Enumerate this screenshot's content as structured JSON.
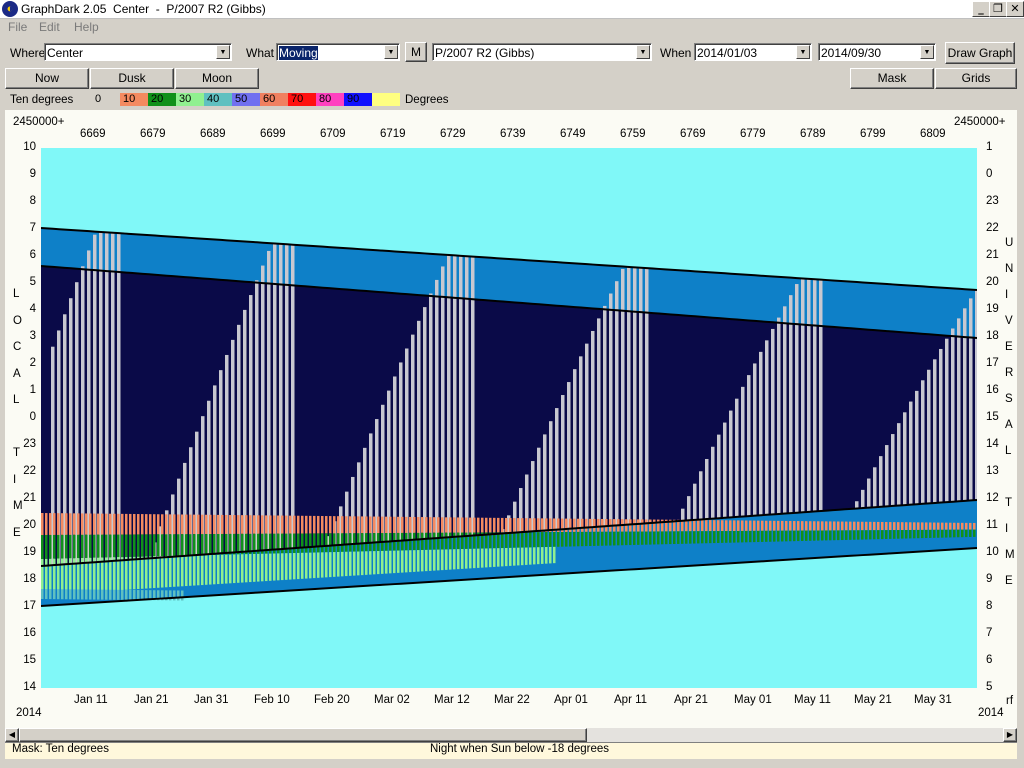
{
  "window": {
    "title": "GraphDark 2.05  Center  -  P/2007 R2 (Gibbs)",
    "minimize": "_",
    "restore": "❐",
    "close": "✕"
  },
  "menu": [
    "File",
    "Edit",
    "Help"
  ],
  "toolbar": {
    "where_label": "Where",
    "where_value": "Center",
    "what_label": "What",
    "what_value": "Moving",
    "m_button": "M",
    "object_value": "P/2007 R2 (Gibbs)",
    "when_label": "When",
    "start_date": "2014/01/03",
    "end_date": "2014/09/30",
    "draw_graph": "Draw Graph"
  },
  "buttons": {
    "now": "Now",
    "dusk": "Dusk",
    "moon": "Moon",
    "mask": "Mask",
    "grids": "Grids"
  },
  "legend": {
    "title": "Ten degrees",
    "unit": "Degrees",
    "entries": [
      {
        "label": "0",
        "color": "#d4d0c8"
      },
      {
        "label": "10",
        "color": "#f48a60"
      },
      {
        "label": "20",
        "color": "#10901a"
      },
      {
        "label": "30",
        "color": "#90f090"
      },
      {
        "label": "40",
        "color": "#5fc0c0"
      },
      {
        "label": "50",
        "color": "#7070f0"
      },
      {
        "label": "60",
        "color": "#f08060"
      },
      {
        "label": "70",
        "color": "#ff1010"
      },
      {
        "label": "80",
        "color": "#ff40c0"
      },
      {
        "label": "90",
        "color": "#1010ff"
      },
      {
        "label": "",
        "color": "#ffff80"
      }
    ]
  },
  "graph": {
    "jd_prefix_left": "2450000+",
    "jd_prefix_right": "2450000+",
    "jd_ticks": [
      "6669",
      "6679",
      "6689",
      "6699",
      "6709",
      "6719",
      "6729",
      "6739",
      "6749",
      "6759",
      "6769",
      "6779",
      "6789",
      "6799",
      "6809"
    ],
    "left_ticks": [
      "10",
      "9",
      "8",
      "7",
      "6",
      "5",
      "4",
      "3",
      "2",
      "1",
      "0",
      "23",
      "22",
      "21",
      "20",
      "19",
      "18",
      "17",
      "16",
      "15",
      "14"
    ],
    "right_ticks": [
      "1",
      "0",
      "23",
      "22",
      "21",
      "20",
      "19",
      "18",
      "17",
      "16",
      "15",
      "14",
      "13",
      "12",
      "11",
      "10",
      "9",
      "8",
      "7",
      "6",
      "5"
    ],
    "left_axis_label": [
      "L",
      "O",
      "C",
      "A",
      "L",
      "",
      "T",
      "I",
      "M",
      "E"
    ],
    "right_axis_label": [
      "U",
      "N",
      "I",
      "V",
      "E",
      "R",
      "S",
      "A",
      "L",
      "",
      "T",
      "I",
      "M",
      "E"
    ],
    "date_ticks": [
      "Jan 11",
      "Jan 21",
      "Jan 31",
      "Feb 10",
      "Feb 20",
      "Mar 02",
      "Mar 12",
      "Mar 22",
      "Apr 01",
      "Apr 11",
      "Apr 21",
      "May 01",
      "May 11",
      "May 21",
      "May 31"
    ],
    "year_left": "2014",
    "year_right": "2014",
    "corner_right": "rf",
    "colors": {
      "day": "#80f8f8",
      "night": "#0a0a48",
      "twilight": "#0e80c8",
      "moon": "#c8c8d0"
    }
  },
  "status": {
    "left": "Mask:  Ten degrees",
    "center": "Night when Sun below -18 degrees"
  }
}
